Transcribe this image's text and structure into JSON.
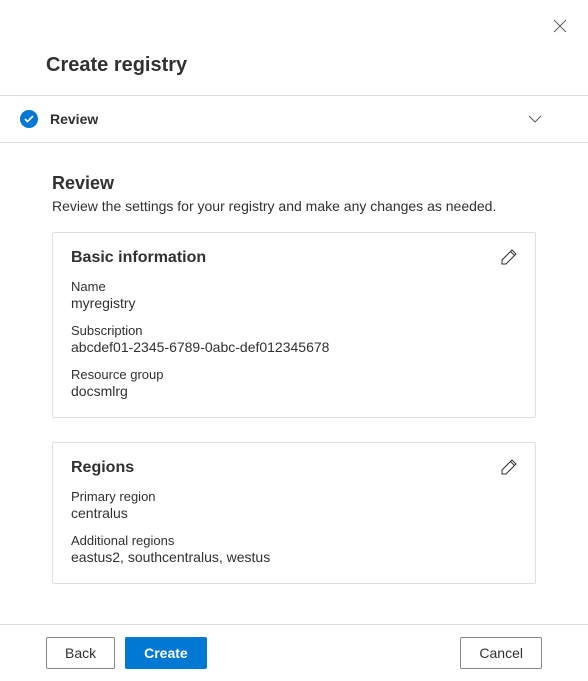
{
  "panel": {
    "title": "Create registry"
  },
  "step": {
    "label": "Review"
  },
  "section": {
    "title": "Review",
    "description": "Review the settings for your registry and make any changes as needed."
  },
  "basicInfo": {
    "title": "Basic information",
    "nameLabel": "Name",
    "nameValue": "myregistry",
    "subscriptionLabel": "Subscription",
    "subscriptionValue": "abcdef01-2345-6789-0abc-def012345678",
    "resourceGroupLabel": "Resource group",
    "resourceGroupValue": "docsmlrg"
  },
  "regions": {
    "title": "Regions",
    "primaryLabel": "Primary region",
    "primaryValue": "centralus",
    "additionalLabel": "Additional regions",
    "additionalValue": "eastus2, southcentralus, westus"
  },
  "footer": {
    "back": "Back",
    "create": "Create",
    "cancel": "Cancel"
  }
}
